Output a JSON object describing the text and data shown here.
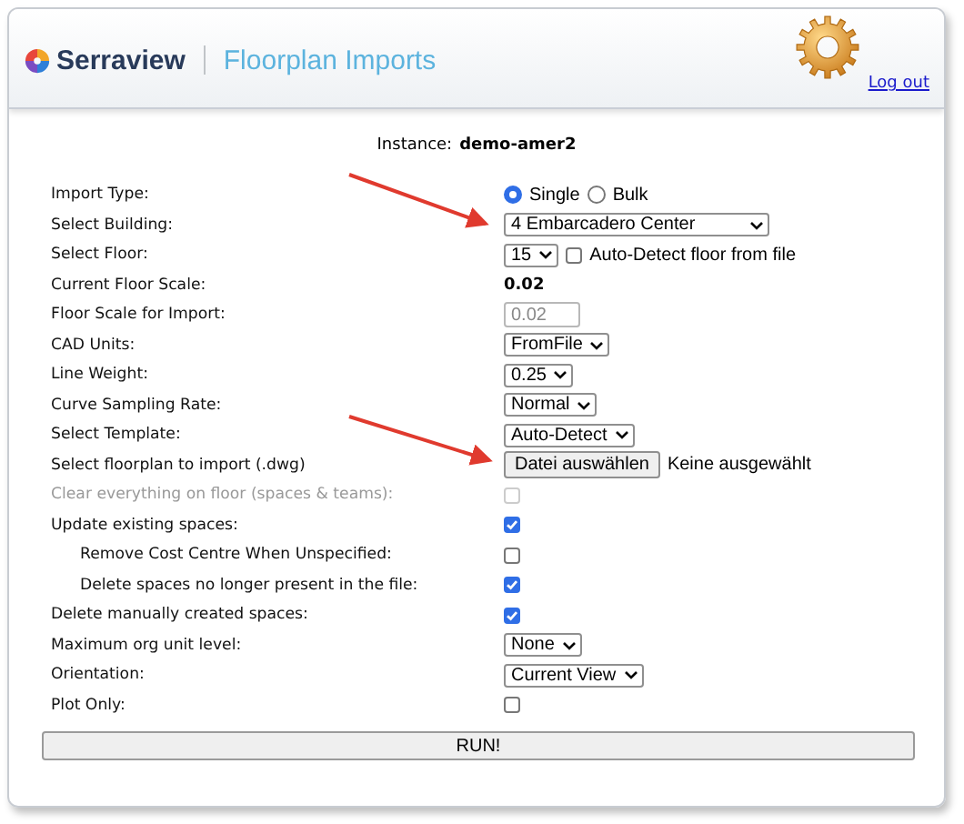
{
  "header": {
    "brand": "Serraview",
    "app_title": "Floorplan Imports",
    "logout": "Log out"
  },
  "instance": {
    "label": "Instance:",
    "value": "demo-amer2"
  },
  "rows": [
    {
      "kind": "radio",
      "label": "Import Type:",
      "options": [
        {
          "label": "Single",
          "selected": true
        },
        {
          "label": "Bulk",
          "selected": false
        }
      ]
    },
    {
      "kind": "select",
      "label": "Select Building:",
      "value": "4 Embarcadero Center",
      "wide": true
    },
    {
      "kind": "select_check",
      "label": "Select Floor:",
      "value": "15",
      "check_label": "Auto-Detect floor from file",
      "checked": false
    },
    {
      "kind": "text",
      "label": "Current Floor Scale:",
      "value": "0.02"
    },
    {
      "kind": "input",
      "label": "Floor Scale for Import:",
      "placeholder": "0.02"
    },
    {
      "kind": "select",
      "label": "CAD Units:",
      "value": "FromFile"
    },
    {
      "kind": "select",
      "label": "Line Weight:",
      "value": "0.25"
    },
    {
      "kind": "select",
      "label": "Curve Sampling Rate:",
      "value": "Normal"
    },
    {
      "kind": "select",
      "label": "Select Template:",
      "value": "Auto-Detect"
    },
    {
      "kind": "file",
      "label": "Select floorplan to import (.dwg)",
      "button": "Datei auswählen",
      "status": "Keine ausgewählt"
    },
    {
      "kind": "checkbox",
      "label": "Clear everything on floor (spaces & teams):",
      "checked": false,
      "disabled": true
    },
    {
      "kind": "checkbox",
      "label": "Update existing spaces:",
      "checked": true,
      "disabled": false,
      "children": [
        {
          "kind": "checkbox",
          "label": "Remove Cost Centre When Unspecified:",
          "checked": false,
          "disabled": false
        },
        {
          "kind": "checkbox",
          "label": "Delete spaces no longer present in the file:",
          "checked": true,
          "disabled": false
        }
      ]
    },
    {
      "kind": "checkbox",
      "label": "Delete manually created spaces:",
      "checked": true,
      "disabled": false
    },
    {
      "kind": "select",
      "label": "Maximum org unit level:",
      "value": "None"
    },
    {
      "kind": "select",
      "label": "Orientation:",
      "value": "Current View"
    },
    {
      "kind": "checkbox",
      "label": "Plot Only:",
      "checked": false,
      "disabled": false
    }
  ],
  "run_button": "RUN!"
}
